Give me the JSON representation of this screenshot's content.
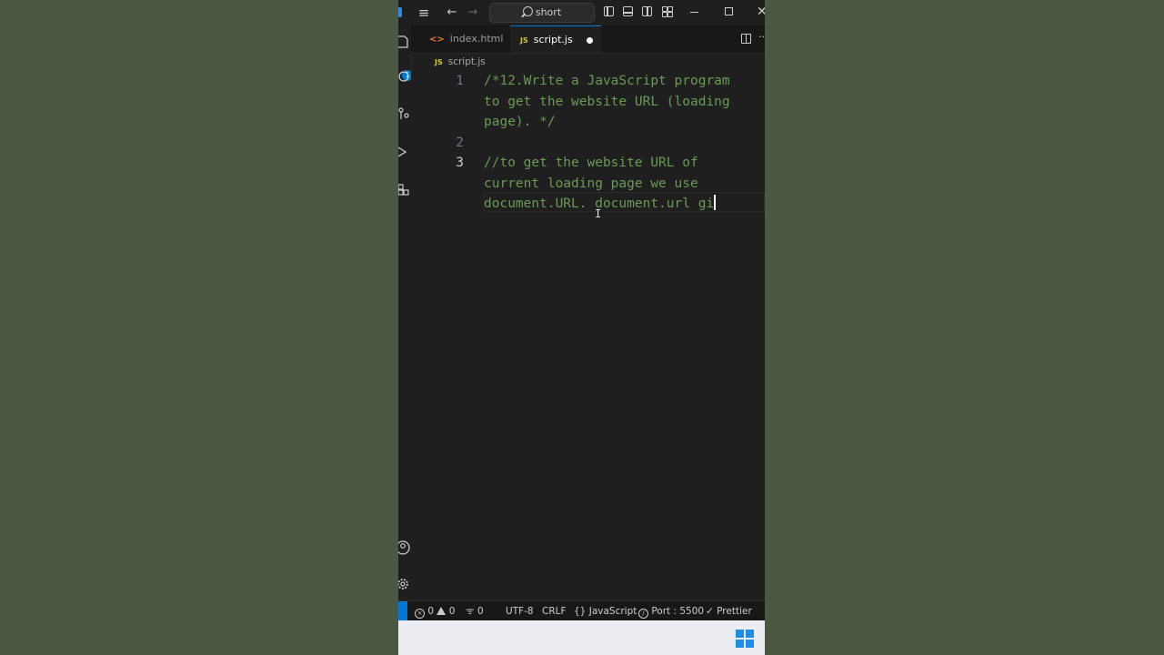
{
  "titlebar": {
    "search_text": "short",
    "back_arrow": "←",
    "forward_arrow": "→",
    "menu_glyph": "≡",
    "close_glyph": "✕"
  },
  "tabs": [
    {
      "label": "index.html",
      "icon": "html-icon",
      "glyph": "<>",
      "active": false
    },
    {
      "label": "script.js",
      "icon": "js-icon",
      "glyph": "JS",
      "active": true,
      "modified": true
    }
  ],
  "breadcrumb": {
    "icon": "JS",
    "file": "script.js"
  },
  "editor": {
    "lines": [
      {
        "number": "1",
        "text": [
          "/*12.Write a JavaScript program",
          "to get the website URL (loading",
          "page). */"
        ]
      },
      {
        "number": "2",
        "text": [
          ""
        ]
      },
      {
        "number": "3",
        "text": [
          "//to get the website URL of",
          "current loading page we use",
          "document.URL. document.url gi"
        ]
      }
    ]
  },
  "activity": {
    "badge": "1"
  },
  "statusbar": {
    "errors": "0",
    "warnings": "0",
    "ports": "0",
    "encoding": "UTF-8",
    "eol": "CRLF",
    "language": "JavaScript",
    "language_glyph": "{}",
    "port_label": "Port : 5500",
    "formatter": "Prettier"
  },
  "colors": {
    "comment": "#6a9955",
    "accent": "#0078d4",
    "background": "#1f1f1f",
    "desktop": "#4b5843"
  }
}
